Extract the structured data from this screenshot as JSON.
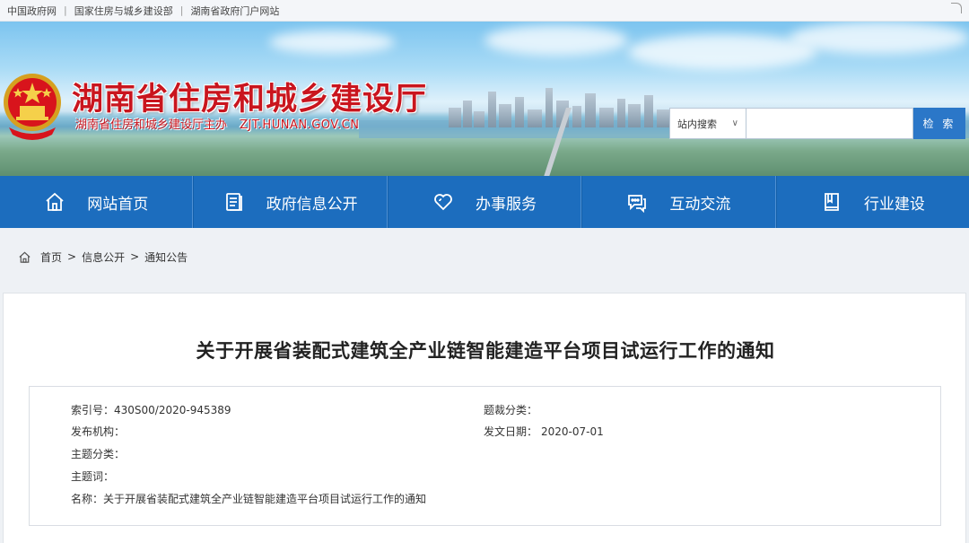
{
  "toplinks": [
    "中国政府网",
    "国家住房与城乡建设部",
    "湖南省政府门户网站"
  ],
  "header": {
    "title": "湖南省住房和城乡建设厅",
    "subtitle": "湖南省住房和城乡建设厅主办",
    "domain": "ZJT.HUNAN.GOV.CN"
  },
  "search": {
    "scope": "站内搜索",
    "placeholder": "",
    "button": "检 索"
  },
  "nav": [
    {
      "label": "网站首页",
      "icon": "home-icon"
    },
    {
      "label": "政府信息公开",
      "icon": "document-icon"
    },
    {
      "label": "办事服务",
      "icon": "heart-icon"
    },
    {
      "label": "互动交流",
      "icon": "chat-icon"
    },
    {
      "label": "行业建设",
      "icon": "book-icon"
    }
  ],
  "breadcrumb": [
    "首页",
    "信息公开",
    "通知公告"
  ],
  "article": {
    "title": "关于开展省装配式建筑全产业链智能建造平台项目试运行工作的通知",
    "meta": {
      "index_label": "索引号：",
      "index_value": "430S00/2020-945389",
      "category_label": "题裁分类：",
      "category_value": "",
      "publisher_label": "发布机构：",
      "publisher_value": "",
      "date_label": "发文日期：",
      "date_value": "2020-07-01",
      "topic_label": "主题分类：",
      "topic_value": "",
      "keywords_label": "主题词：",
      "keywords_value": "",
      "name_label": "名称：",
      "name_value": "关于开展省装配式建筑全产业链智能建造平台项目试运行工作的通知"
    }
  },
  "colors": {
    "brand_red": "#c9151e",
    "nav_blue": "#1c6dbe",
    "search_button": "#2b77c8"
  }
}
